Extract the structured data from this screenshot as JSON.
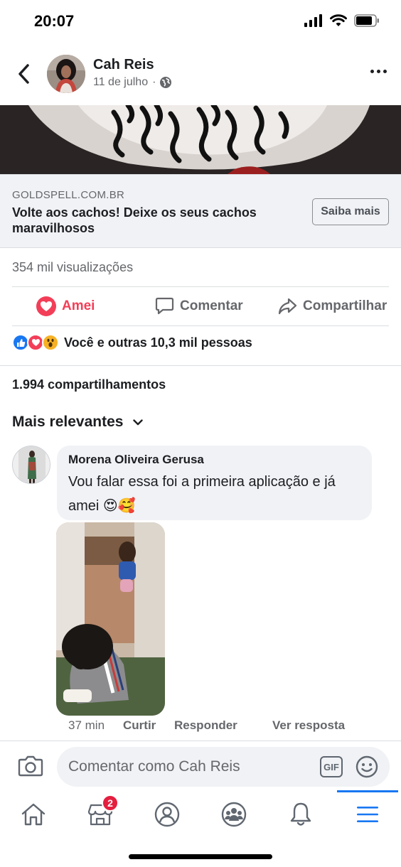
{
  "status_bar": {
    "time": "20:07"
  },
  "post": {
    "author": "Cah Reis",
    "date": "11 de julho",
    "separator": "·"
  },
  "link_card": {
    "domain": "GOLDSPELL.COM.BR",
    "title": "Volte aos cachos! Deixe os seus cachos maravilhosos",
    "cta": "Saiba mais"
  },
  "stats": {
    "views": "354 mil visualizações",
    "reactions": "Você e outras 10,3 mil pessoas",
    "shares": "1.994 compartilhamentos"
  },
  "actions": {
    "love": "Amei",
    "comment": "Comentar",
    "share": "Compartilhar"
  },
  "comments": {
    "sort_label": "Mais relevantes",
    "items": [
      {
        "author": "Morena Oliveira Gerusa",
        "text": "Vou falar essa foi a primeira aplicação e já amei 😍🥰",
        "time": "37 min",
        "like": "Curtir",
        "reply": "Responder",
        "see_reply": "Ver resposta"
      }
    ]
  },
  "composer": {
    "placeholder": "Comentar como Cah Reis",
    "gif_label": "GIF"
  },
  "tab_bar": {
    "marketplace_badge": "2"
  },
  "colors": {
    "love": "#f33e58",
    "like": "#1877f2",
    "accent": "#1877f2",
    "badge": "#e41e3f"
  }
}
